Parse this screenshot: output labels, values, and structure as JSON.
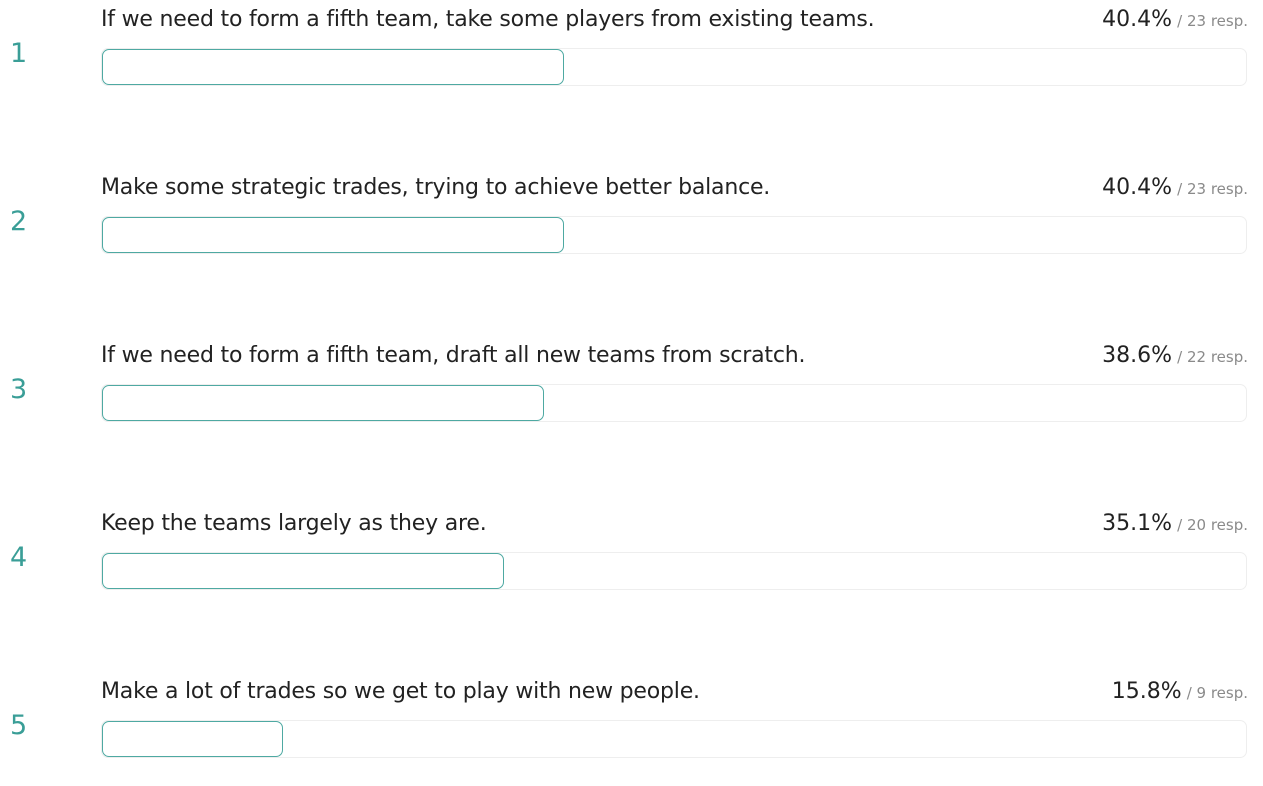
{
  "chart_data": {
    "type": "bar",
    "categories": [
      "If we need to form a fifth team, take some players from existing teams.",
      "Make some strategic trades, trying to achieve better balance.",
      "If we need to form a fifth team, draft all new teams from scratch.",
      "Keep the teams largely as they are.",
      "Make a lot of trades so we get to play with new people."
    ],
    "values": [
      40.4,
      40.4,
      38.6,
      35.1,
      15.8
    ],
    "value_unit": "%",
    "responses": [
      23,
      23,
      22,
      20,
      9
    ],
    "xlim": [
      0,
      100
    ],
    "orientation": "horizontal",
    "grid": false,
    "legend": "none",
    "colors": {
      "bar_outline": "#4ea9a2",
      "rank_text": "#3a9e97",
      "track_border": "#eeeeee"
    }
  },
  "items": [
    {
      "rank": "1",
      "label": "If we need to form a fifth team, take some players from existing teams.",
      "percent": "40.4%",
      "responses": "/ 23 resp."
    },
    {
      "rank": "2",
      "label": "Make some strategic trades, trying to achieve better balance.",
      "percent": "40.4%",
      "responses": "/ 23 resp."
    },
    {
      "rank": "3",
      "label": "If we need to form a fifth team, draft all new teams from scratch.",
      "percent": "38.6%",
      "responses": "/ 22 resp."
    },
    {
      "rank": "4",
      "label": "Keep the teams largely as they are.",
      "percent": "35.1%",
      "responses": "/ 20 resp."
    },
    {
      "rank": "5",
      "label": "Make a lot of trades so we get to play with new people.",
      "percent": "15.8%",
      "responses": "/ 9 resp."
    }
  ]
}
